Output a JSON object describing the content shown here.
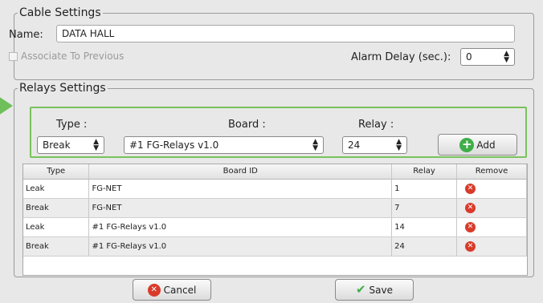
{
  "cable_settings": {
    "legend": "Cable Settings",
    "name_label": "Name:",
    "name_value": "DATA HALL",
    "associate_label": "Associate To Previous",
    "alarm_delay_label": "Alarm Delay (sec.):",
    "alarm_delay_value": "0"
  },
  "relays_settings": {
    "legend": "Relays Settings",
    "type_label": "Type :",
    "board_label": "Board :",
    "relay_label": "Relay :",
    "type_value": "Break",
    "board_value": "#1 FG-Relays v1.0",
    "relay_value": "24",
    "add_label": "Add"
  },
  "table": {
    "headers": [
      "Type",
      "Board ID",
      "Relay",
      "Remove"
    ],
    "rows": [
      {
        "type": "Leak",
        "board": "FG-NET",
        "relay": "1"
      },
      {
        "type": "Break",
        "board": "FG-NET",
        "relay": "7"
      },
      {
        "type": "Leak",
        "board": "#1 FG-Relays v1.0",
        "relay": "14"
      },
      {
        "type": "Break",
        "board": "#1 FG-Relays v1.0",
        "relay": "24"
      }
    ]
  },
  "buttons": {
    "cancel_label": "Cancel",
    "save_label": "Save"
  },
  "icons": {
    "add": "plus-circle-icon",
    "remove": "x-circle-icon",
    "cancel": "x-circle-icon",
    "save": "checkmark-icon"
  },
  "colors": {
    "highlight_green": "#7ac25b",
    "remove_red": "#d93b2b",
    "add_green": "#3fae48"
  }
}
